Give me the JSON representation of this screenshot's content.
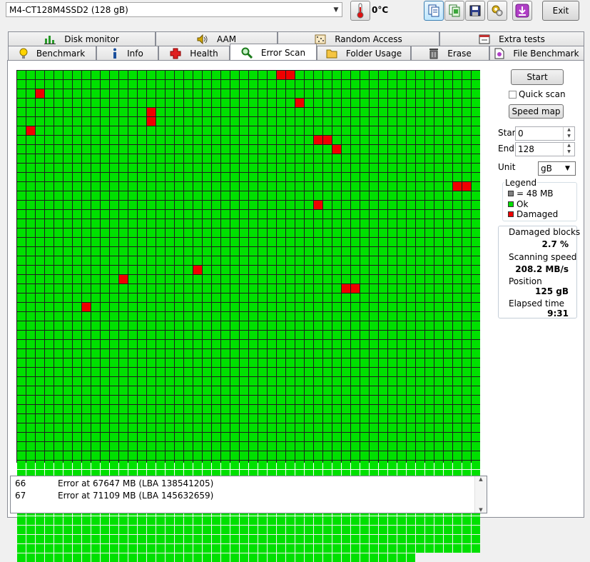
{
  "toolbar": {
    "drive": "M4-CT128M4SSD2 (128 gB)",
    "temperature": "0°C",
    "exit_label": "Exit",
    "buttons": [
      "copy-text-icon",
      "copy-image-icon",
      "save-icon",
      "options-icon",
      "download-icon"
    ]
  },
  "tabs_row1": [
    "Disk monitor",
    "AAM",
    "Random Access",
    "Extra tests"
  ],
  "tabs_row2": [
    "Benchmark",
    "Info",
    "Health",
    "Error Scan",
    "Folder Usage",
    "Erase",
    "File Benchmark"
  ],
  "active_tab": "Error Scan",
  "scan_map": {
    "columns": 50,
    "rows": 42,
    "ok_color": "#00e000",
    "damaged_color": "#f00000",
    "unscanned_color": "#808080",
    "scanned_blocks": 2643,
    "damaged_blocks": [
      [
        28,
        0
      ],
      [
        29,
        0
      ],
      [
        2,
        2
      ],
      [
        30,
        3
      ],
      [
        14,
        4
      ],
      [
        14,
        5
      ],
      [
        1,
        6
      ],
      [
        32,
        7
      ],
      [
        33,
        7
      ],
      [
        34,
        8
      ],
      [
        47,
        12
      ],
      [
        48,
        12
      ],
      [
        32,
        14
      ],
      [
        19,
        21
      ],
      [
        11,
        22
      ],
      [
        35,
        23
      ],
      [
        36,
        23
      ],
      [
        7,
        25
      ]
    ]
  },
  "controls": {
    "start_label": "Start",
    "quick_scan_label": "Quick scan",
    "speed_map_label": "Speed map",
    "start_field_label": "Start",
    "start_value": "0",
    "end_field_label": "End",
    "end_value": "128",
    "unit_label": "Unit",
    "unit_value": "gB"
  },
  "legend": {
    "title": "Legend",
    "block_size": "= 48 MB",
    "ok": "Ok",
    "damaged": "Damaged"
  },
  "stats": {
    "damaged_label": "Damaged blocks",
    "damaged_value": "2.7 %",
    "speed_label": "Scanning speed",
    "speed_value": "208.2 MB/s",
    "position_label": "Position",
    "position_value": "125 gB",
    "elapsed_label": "Elapsed time",
    "elapsed_value": "9:31"
  },
  "log": [
    {
      "num": "66",
      "text": "Error at 67647 MB (LBA 138541205)"
    },
    {
      "num": "67",
      "text": "Error at 71109 MB (LBA 145632659)"
    }
  ]
}
